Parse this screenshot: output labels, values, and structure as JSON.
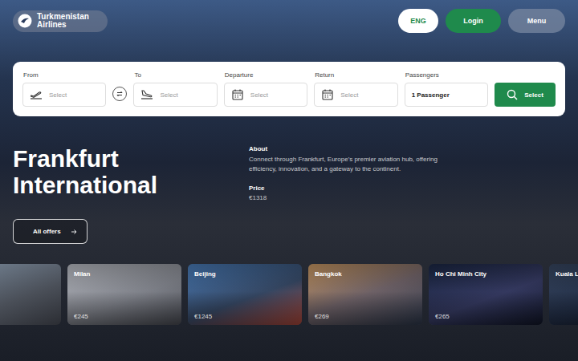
{
  "header": {
    "logo": "Turkmenistan Airlines",
    "language": "ENG",
    "login": "Login",
    "menu": "Menu"
  },
  "search": {
    "fields": [
      {
        "label": "From",
        "placeholder": "Select",
        "kind": "from"
      },
      {
        "label": "To",
        "placeholder": "Select",
        "kind": "to"
      },
      {
        "label": "Departure",
        "placeholder": "Select",
        "kind": "date"
      },
      {
        "label": "Return",
        "placeholder": "Select",
        "kind": "date"
      },
      {
        "label": "Passengers",
        "value": "1 Passenger",
        "kind": "count"
      }
    ],
    "button": "Select"
  },
  "hero": {
    "title": "Frankfurt International",
    "about_label": "About",
    "about": "Connect through Frankfurt, Europe's premier aviation hub, offering efficiency, innovation, and a gateway to the continent.",
    "price_label": "Price",
    "price": "€1318",
    "offers_button": "All offers"
  },
  "destinations": [
    {
      "name": "Milan",
      "price": "€245"
    },
    {
      "name": "Beijing",
      "price": "€1245"
    },
    {
      "name": "Bangkok",
      "price": "€269"
    },
    {
      "name": "Ho Chi Minh City",
      "price": "€265"
    },
    {
      "name": "Kuala L"
    }
  ]
}
